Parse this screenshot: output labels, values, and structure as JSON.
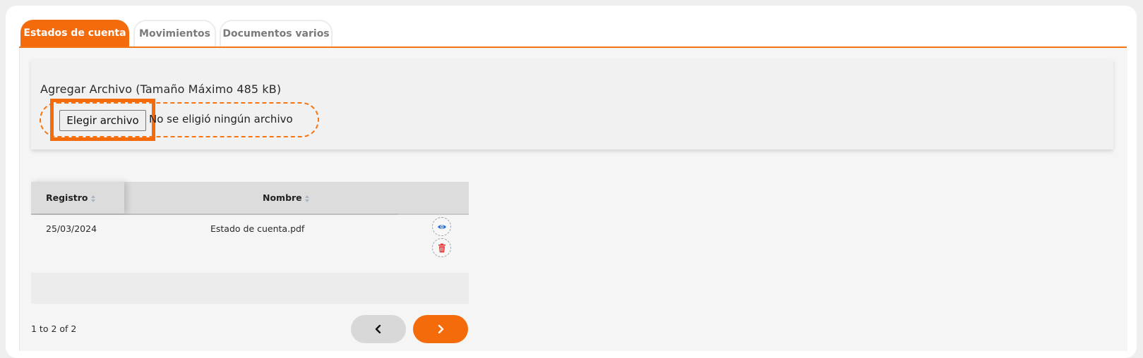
{
  "tabs": [
    {
      "label": "Estados de cuenta",
      "active": true
    },
    {
      "label": "Movimientos",
      "active": false
    },
    {
      "label": "Documentos varios",
      "active": false
    }
  ],
  "upload": {
    "label": "Agregar Archivo (Tamaño Máximo 485 kB)",
    "button_label": "Elegir archivo",
    "status": "No se eligió ningún archivo"
  },
  "table": {
    "headers": [
      "Registro",
      "Nombre"
    ],
    "rows": [
      {
        "fecha": "25/03/2024",
        "nombre": "Estado de cuenta.pdf"
      }
    ]
  },
  "pagination": {
    "summary": "1 to 2 of 2"
  },
  "colors": {
    "accent": "#f46b0c",
    "view_icon": "#2f6fd6",
    "delete_icon": "#e53935"
  },
  "icons": {
    "view": "eye-icon",
    "delete": "trash-icon",
    "prev": "chevron-left-icon",
    "next": "chevron-right-icon"
  }
}
